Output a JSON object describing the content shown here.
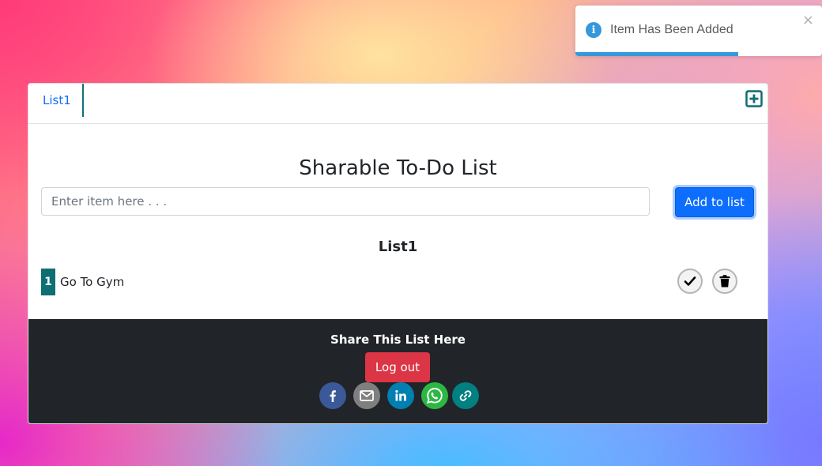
{
  "toast": {
    "message": "Item Has Been Added",
    "close_label": "×",
    "icon": "info-icon",
    "progress_fraction": 0.66,
    "color": "#3498db"
  },
  "tabs": [
    {
      "label": "List1",
      "active": true
    }
  ],
  "add_tab_icon": "plus-square-icon",
  "page": {
    "title": "Sharable To-Do List",
    "input_placeholder": "Enter item here . . .",
    "input_value": "",
    "add_button_label": "Add to list"
  },
  "list": {
    "title": "List1",
    "items": [
      {
        "number": "1",
        "text": "Go To Gym"
      }
    ]
  },
  "footer": {
    "share_title": "Share This List Here",
    "logout_label": "Log out",
    "share_buttons": [
      {
        "icon": "facebook-icon",
        "color": "#3b5998"
      },
      {
        "icon": "email-icon",
        "color": "#7f7f7f"
      },
      {
        "icon": "linkedin-icon",
        "color": "#007fb1"
      },
      {
        "icon": "whatsapp-icon",
        "color": "#2cb742"
      },
      {
        "icon": "link-icon",
        "color": "#008080"
      }
    ]
  },
  "colors": {
    "accent": "#0d6efd",
    "teal": "#0d6e73",
    "danger": "#dc3545",
    "footer_bg": "#212529"
  }
}
